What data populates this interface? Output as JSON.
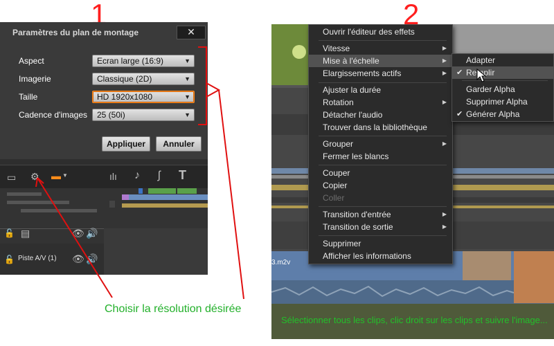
{
  "step1": {
    "number": "1"
  },
  "step2": {
    "number": "2"
  },
  "dialog": {
    "title": "Paramètres du plan de montage",
    "close_label": "✕",
    "rows": [
      {
        "label": "Aspect",
        "value": "Ecran large (16:9)"
      },
      {
        "label": "Imagerie",
        "value": "Classique (2D)"
      },
      {
        "label": "Taille",
        "value": "HD 1920x1080"
      },
      {
        "label": "Cadence d'images",
        "value": "25 (50i)"
      }
    ],
    "apply_label": "Appliquer",
    "cancel_label": "Annuler"
  },
  "timeline1": {
    "track_label": "Piste A/V (1)"
  },
  "context_menu": {
    "items": [
      {
        "label": "Ouvrir l'éditeur des effets"
      },
      {
        "label": "Vitesse",
        "submenu": true
      },
      {
        "label": "Mise à l'échelle",
        "submenu": true,
        "highlighted": true
      },
      {
        "label": "Elargissements actifs",
        "submenu": true
      },
      {
        "label": "Ajuster la durée"
      },
      {
        "label": "Rotation",
        "submenu": true
      },
      {
        "label": "Détacher l'audio"
      },
      {
        "label": "Trouver dans la bibliothèque"
      },
      {
        "label": "Grouper",
        "submenu": true
      },
      {
        "label": "Fermer les blancs"
      },
      {
        "label": "Couper"
      },
      {
        "label": "Copier"
      },
      {
        "label": "Coller",
        "disabled": true
      },
      {
        "label": "Transition d'entrée",
        "submenu": true
      },
      {
        "label": "Transition de sortie",
        "submenu": true
      },
      {
        "label": "Supprimer"
      },
      {
        "label": "Afficher les informations"
      }
    ]
  },
  "scale_submenu": {
    "items": [
      {
        "label": "Adapter",
        "checked": false
      },
      {
        "label": "Remplir",
        "checked": true,
        "highlighted": true
      },
      {
        "label": "Garder Alpha",
        "checked": false
      },
      {
        "label": "Supprimer Alpha",
        "checked": false
      },
      {
        "label": "Générer Alpha",
        "checked": true
      }
    ]
  },
  "clip": {
    "name": "3.m2v"
  },
  "captions": {
    "resolution": "Choisir la résolution désirée",
    "instructions": "Sélectionner tous les clips, clic droit sur les clips et suivre l'image..."
  },
  "colors": {
    "annotation_red": "#e01010",
    "caption_green": "#22b02a",
    "dialog_highlight_border": "#ff8a1c"
  }
}
